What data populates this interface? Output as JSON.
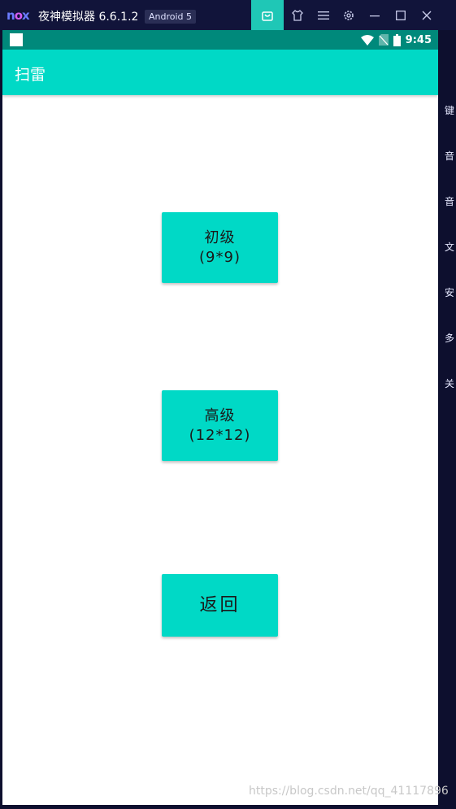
{
  "emulator": {
    "app_name": "夜神模拟器 6.6.1.2",
    "android_version": "Android 5",
    "side_toolbar": [
      "键",
      "音",
      "音",
      "文",
      "安",
      "多",
      "关"
    ]
  },
  "status_bar": {
    "time": "9:45"
  },
  "app_bar": {
    "title": "扫雷"
  },
  "buttons": {
    "easy": {
      "line1": "初级",
      "line2": "(9*9)"
    },
    "hard": {
      "line1": "高级",
      "line2": "(12*12)"
    },
    "back": {
      "label": "返回"
    }
  },
  "watermark": "https://blog.csdn.net/qq_41117896",
  "colors": {
    "accent": "#00d9c6",
    "status_bar": "#00897b",
    "emulator_bg": "#0d0f2e"
  }
}
